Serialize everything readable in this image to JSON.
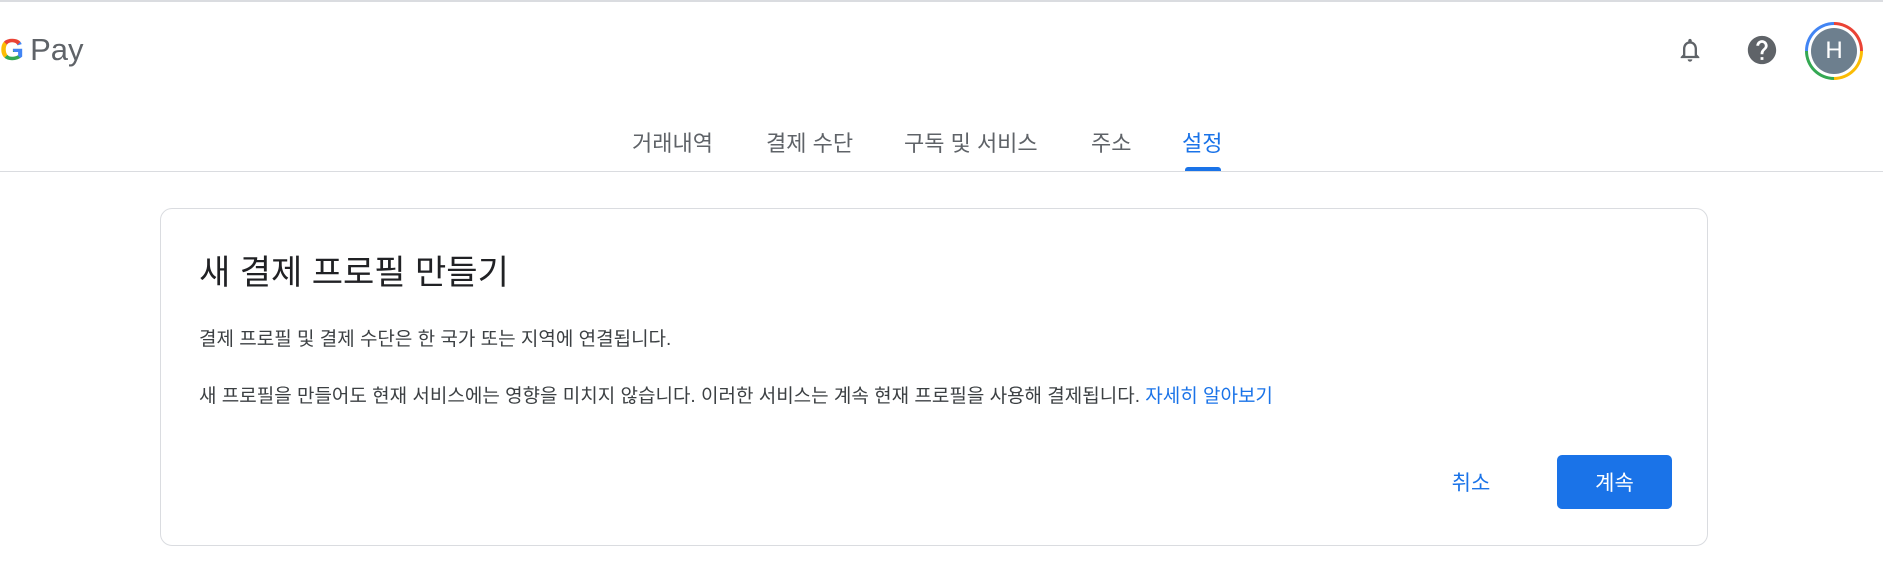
{
  "header": {
    "logo_g": "G",
    "logo_text": "Pay",
    "avatar_initial": "H",
    "icons": [
      "bell-icon",
      "help-icon"
    ]
  },
  "tabs": [
    {
      "label": "거래내역",
      "active": false
    },
    {
      "label": "결제 수단",
      "active": false
    },
    {
      "label": "구독 및 서비스",
      "active": false
    },
    {
      "label": "주소",
      "active": false
    },
    {
      "label": "설정",
      "active": true
    }
  ],
  "card": {
    "title": "새 결제 프로필 만들기",
    "paragraph1": "결제 프로필 및 결제 수단은 한 국가 또는 지역에 연결됩니다.",
    "paragraph2": "새 프로필을 만들어도 현재 서비스에는 영향을 미치지 않습니다. 이러한 서비스는 계속 현재 프로필을 사용해 결제됩니다.",
    "learn_more": "자세히 알아보기",
    "cancel_label": "취소",
    "continue_label": "계속"
  },
  "colors": {
    "accent": "#1a73e8",
    "avatar_bg": "#6d7f8e",
    "divider": "#dadce0"
  }
}
